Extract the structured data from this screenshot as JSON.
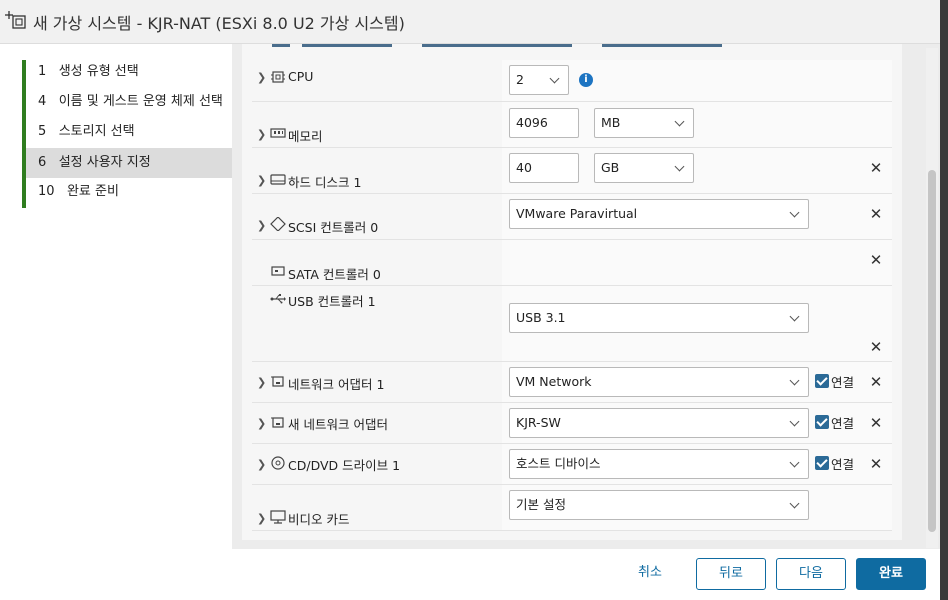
{
  "window": {
    "title": "새 가상 시스템 - KJR-NAT (ESXi 8.0 U2 가상 시스템)",
    "icon": "new-vm-icon"
  },
  "steps": [
    {
      "num": "1",
      "label": "생성 유형 선택",
      "active": false
    },
    {
      "num": "4",
      "label": "이름 및 게스트 운영 체제 선택",
      "active": false
    },
    {
      "num": "5",
      "label": "스토리지 선택",
      "active": false
    },
    {
      "num": "6",
      "label": "설정 사용자 지정",
      "active": true
    },
    {
      "num": "10",
      "label": "완료 준비",
      "active": false
    }
  ],
  "hardware": {
    "cpu": {
      "label": "CPU",
      "value": "2",
      "icon": "cpu-icon"
    },
    "memory": {
      "label": "메모리",
      "value": "4096",
      "unit": "MB",
      "icon": "memory-icon"
    },
    "disk": {
      "label": "하드 디스크 1",
      "value": "40",
      "unit": "GB",
      "icon": "hard-disk-icon"
    },
    "scsi": {
      "label": "SCSI 컨트롤러 0",
      "value": "VMware Paravirtual",
      "icon": "scsi-icon"
    },
    "sata": {
      "label": "SATA 컨트롤러 0",
      "icon": "sata-icon"
    },
    "usb": {
      "label": "USB 컨트롤러 1",
      "value": "USB 3.1",
      "icon": "usb-icon"
    },
    "nic1": {
      "label": "네트워크 어댑터 1",
      "value": "VM Network",
      "connect": "연결",
      "icon": "network-adapter-icon"
    },
    "nic2": {
      "label": "새 네트워크 어댑터",
      "value": "KJR-SW",
      "connect": "연결",
      "icon": "network-adapter-icon"
    },
    "cdrom": {
      "label": "CD/DVD 드라이브 1",
      "value": "호스트 디바이스",
      "connect": "연결",
      "icon": "cd-dvd-icon"
    },
    "video": {
      "label": "비디오 카드",
      "value": "기본 설정",
      "icon": "monitor-icon"
    }
  },
  "footer": {
    "cancel": "취소",
    "back": "뒤로",
    "next": "다음",
    "finish": "완료"
  },
  "colors": {
    "accent": "#0f6ba1",
    "step_bar": "#2f7d1f",
    "checkbox": "#2b6a97",
    "info": "#1d74c2"
  }
}
